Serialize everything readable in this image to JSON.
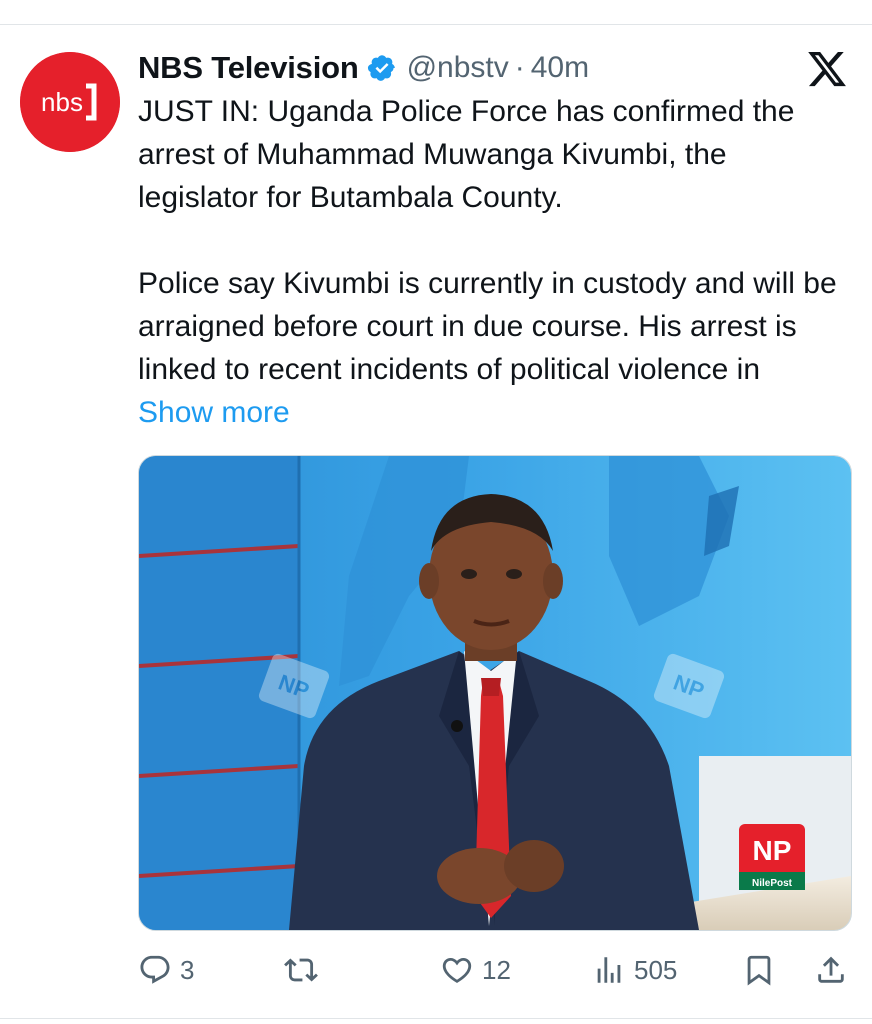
{
  "tweet": {
    "display_name": "NBS Television",
    "handle": "@nbstv",
    "separator": "·",
    "time": "40m",
    "avatar_text": "nbs",
    "paragraph1": "JUST IN: Uganda Police Force has confirmed the arrest of Muhammad Muwanga Kivumbi, the legislator for Butambala County.",
    "paragraph2": "Police say Kivumbi is currently in custody and will be arraigned before court in due course. His arrest is linked to recent incidents of political violence in",
    "show_more": "Show more",
    "media": {
      "logo_text": "NP",
      "logo_caption": "NilePost",
      "watermark_text": "NP"
    }
  },
  "actions": {
    "replies": "3",
    "reposts": "",
    "likes": "12",
    "views": "505"
  },
  "icons": {
    "verified": "verified-badge-icon",
    "x_logo": "x-logo-icon",
    "reply": "reply-icon",
    "repost": "repost-icon",
    "like": "heart-icon",
    "views": "views-icon",
    "bookmark": "bookmark-icon",
    "share": "share-icon"
  },
  "colors": {
    "brand_red": "#e5202b",
    "link_blue": "#1d9bf0",
    "muted": "#536471",
    "verified_blue": "#1d9bf0"
  }
}
